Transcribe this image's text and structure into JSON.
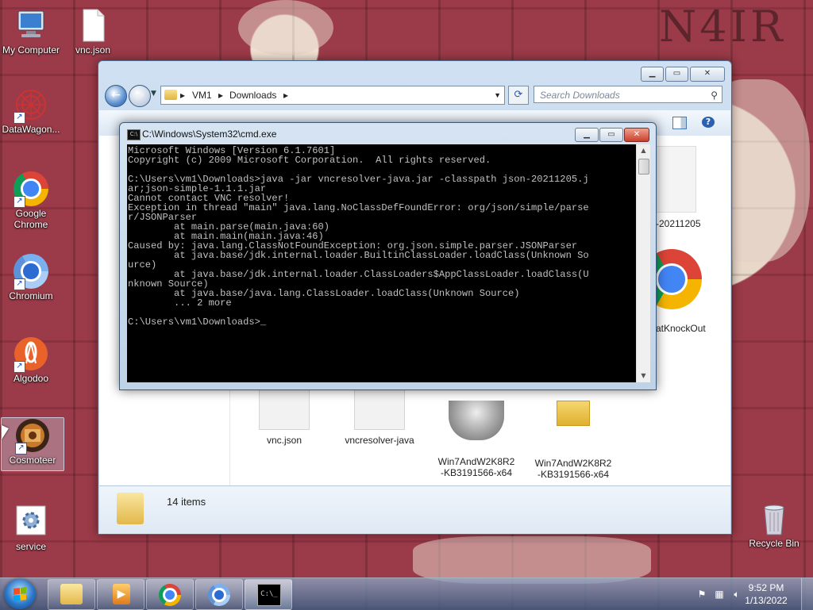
{
  "desktop": {
    "icons": [
      {
        "label": "My Computer"
      },
      {
        "label": "vnc.json"
      },
      {
        "label": "DataWagon..."
      },
      {
        "label": "Google Chrome"
      },
      {
        "label": "Chromium"
      },
      {
        "label": "Algodoo"
      },
      {
        "label": "Cosmoteer"
      },
      {
        "label": "service"
      },
      {
        "label": "Recycle Bin"
      }
    ],
    "wallpaper_text": "N4IR"
  },
  "explorer": {
    "breadcrumb": [
      "VM1",
      "Downloads"
    ],
    "search_placeholder": "Search Downloads",
    "files": [
      {
        "label": "vnc.json"
      },
      {
        "label": "vncresolver-java"
      },
      {
        "label": "Win7AndW2K8R2\n-KB3191566-x64"
      },
      {
        "label": "Win7AndW2K8R2\n-KB3191566-x64"
      }
    ],
    "partial_labels": [
      "-20211205",
      "atKnockOut"
    ],
    "status": "14 items"
  },
  "cmd": {
    "title": "C:\\Windows\\System32\\cmd.exe",
    "output": "Microsoft Windows [Version 6.1.7601]\nCopyright (c) 2009 Microsoft Corporation.  All rights reserved.\n\nC:\\Users\\vm1\\Downloads>java -jar vncresolver-java.jar -classpath json-20211205.j\nar;json-simple-1.1.1.jar\nCannot contact VNC resolver!\nException in thread \"main\" java.lang.NoClassDefFoundError: org/json/simple/parse\nr/JSONParser\n        at main.parse(main.java:60)\n        at main.main(main.java:46)\nCaused by: java.lang.ClassNotFoundException: org.json.simple.parser.JSONParser\n        at java.base/jdk.internal.loader.BuiltinClassLoader.loadClass(Unknown So\nurce)\n        at java.base/jdk.internal.loader.ClassLoaders$AppClassLoader.loadClass(U\nnknown Source)\n        at java.base/java.lang.ClassLoader.loadClass(Unknown Source)\n        ... 2 more\n\nC:\\Users\\vm1\\Downloads>_"
  },
  "taskbar": {
    "time": "9:52 PM",
    "date": "1/13/2022",
    "items": [
      "explorer",
      "media-player",
      "google-chrome",
      "chromium",
      "cmd"
    ]
  }
}
